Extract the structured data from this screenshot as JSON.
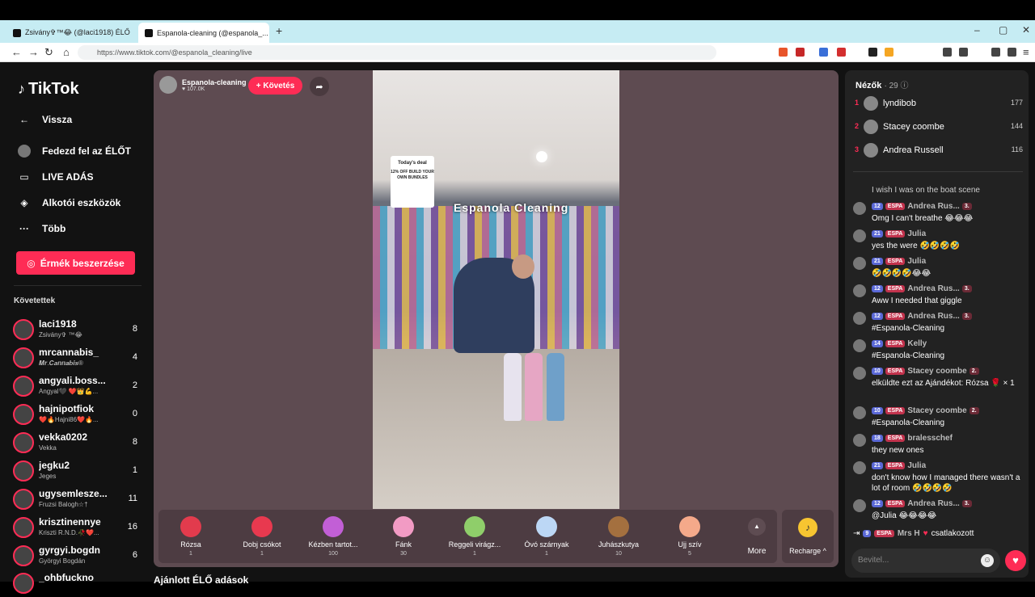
{
  "browser": {
    "tabs": [
      {
        "title": "Zsivány✞™😂 (@laci1918) ÉLŐ",
        "active": false
      },
      {
        "title": "Espanola-cleaning (@espanola_...",
        "active": true
      }
    ],
    "new_tab": "+",
    "url": "https://www.tiktok.com/@espanola_cleaning/live",
    "win_min": "–",
    "win_max": "▢",
    "win_close": "✕"
  },
  "sidebar": {
    "brand": "TikTok",
    "back": "Vissza",
    "nav": [
      {
        "label": "Fedezd fel az ÉLŐT",
        "icon": "avatar-icon"
      },
      {
        "label": "LIVE ADÁS",
        "icon": "video-icon"
      },
      {
        "label": "Alkotói eszközök",
        "icon": "creator-tools-icon"
      },
      {
        "label": "Több",
        "icon": "more-icon"
      }
    ],
    "coins_button": "Érmék beszerzése",
    "following_title": "Követettek",
    "following": [
      {
        "name": "laci1918",
        "sub": "Zsivány✞ ™😂",
        "count": "8"
      },
      {
        "name": "mrcannabis_",
        "sub": "𝑴𝒓.𝑪𝒂𝒏𝒏𝒂𝒃𝒊𝒔®",
        "count": "4"
      },
      {
        "name": "angyali.boss...",
        "sub": "Angyal🖤 ❤️👑💪...",
        "count": "2"
      },
      {
        "name": "hajnipotfiok",
        "sub": "❤️🔥Hajni86❤️🔥...",
        "count": "0"
      },
      {
        "name": "vekka0202",
        "sub": "Vekka",
        "count": "8"
      },
      {
        "name": "jegku2",
        "sub": "Jeges",
        "count": "1"
      },
      {
        "name": "ugysemlesze...",
        "sub": "Fruzsi Balogh☆†",
        "count": "11"
      },
      {
        "name": "krisztinennye",
        "sub": "Kriszti R.N.D.🥀❤️...",
        "count": "16"
      },
      {
        "name": "gyrgyi.bogdn",
        "sub": "Györgyi Bogdán",
        "count": "6"
      },
      {
        "name": "_ohbfuckno",
        "sub": "",
        "count": ""
      }
    ]
  },
  "stage": {
    "host_name": "Espanola-cleaning",
    "host_likes": "♥ 107.0K",
    "follow_button": "+ Követés",
    "share_icon": "share-icon",
    "deal_title": "Today's deal",
    "deal_text": "12% OFF BUILD YOUR OWN BUNDLES",
    "store_sign": "Espanola Cleaning",
    "gifts": [
      {
        "name": "Rózsa",
        "price": "1",
        "color": "#e23b4d"
      },
      {
        "name": "Dobj csókot",
        "price": "1",
        "color": "#e8394f"
      },
      {
        "name": "Kézben tartot...",
        "price": "100",
        "color": "#c25fd6"
      },
      {
        "name": "Fánk",
        "price": "30",
        "color": "#f29bc4"
      },
      {
        "name": "Reggeli virágz...",
        "price": "1",
        "color": "#8fce6a"
      },
      {
        "name": "Óvó szárnyak",
        "price": "1",
        "color": "#bcd7f5"
      },
      {
        "name": "Juhászkutya",
        "price": "10",
        "color": "#a4703f"
      },
      {
        "name": "Ujj szív",
        "price": "5",
        "color": "#f4a98a"
      }
    ],
    "more_label": "More",
    "recharge_label": "Recharge ^",
    "recommended_title": "Ajánlott ÉLŐ adások"
  },
  "chat": {
    "viewers_label": "Nézők",
    "viewers_count": "· 29 ⓘ",
    "top_viewers": [
      {
        "rank": "1",
        "name": "lyndibob",
        "score": "177"
      },
      {
        "rank": "2",
        "name": "Stacey coombe",
        "score": "144"
      },
      {
        "rank": "3",
        "name": "Andrea Russell",
        "score": "116"
      }
    ],
    "messages": [
      {
        "level": "",
        "fan": "",
        "user": "",
        "rank": "",
        "text": "I wish I was on the boat scene"
      },
      {
        "level": "12",
        "fan": "ESPA",
        "user": "Andrea Rus...",
        "rank": "3.",
        "text": "Omg I can't breathe 😂😂😂"
      },
      {
        "level": "21",
        "fan": "ESPA",
        "user": "Julia",
        "rank": "",
        "text": "yes the were 🤣🤣🤣🤣"
      },
      {
        "level": "21",
        "fan": "ESPA",
        "user": "Julia",
        "rank": "",
        "text": "🤣🤣🤣🤣😂😂"
      },
      {
        "level": "12",
        "fan": "ESPA",
        "user": "Andrea Rus...",
        "rank": "3.",
        "text": "Aww I needed that giggle"
      },
      {
        "level": "12",
        "fan": "ESPA",
        "user": "Andrea Rus...",
        "rank": "3.",
        "text": "#Espanola-Cleaning"
      },
      {
        "level": "14",
        "fan": "ESPA",
        "user": "Kelly",
        "rank": "",
        "text": "#Espanola-Cleaning"
      },
      {
        "level": "10",
        "fan": "ESPA",
        "user": "Stacey coombe",
        "rank": "2.",
        "text": "elküldte ezt az Ajándékot: Rózsa 🌹 × 1"
      },
      {
        "level": "10",
        "fan": "ESPA",
        "user": "Stacey coombe",
        "rank": "2.",
        "text": "#Espanola-Cleaning"
      },
      {
        "level": "18",
        "fan": "ESPA",
        "user": "bralesschef",
        "rank": "",
        "text": "they new ones"
      },
      {
        "level": "21",
        "fan": "ESPA",
        "user": "Julia",
        "rank": "",
        "text": "don't know how I managed there wasn't a lot of room 🤣🤣🤣🤣"
      },
      {
        "level": "12",
        "fan": "ESPA",
        "user": "Andrea Rus...",
        "rank": "3.",
        "text": "@Julia 😂😂😂😂"
      }
    ],
    "join_level": "9",
    "join_fan": "ESPA",
    "join_user": "Mrs H",
    "join_text": "csatlakozott",
    "input_placeholder": "Bevitel..."
  }
}
